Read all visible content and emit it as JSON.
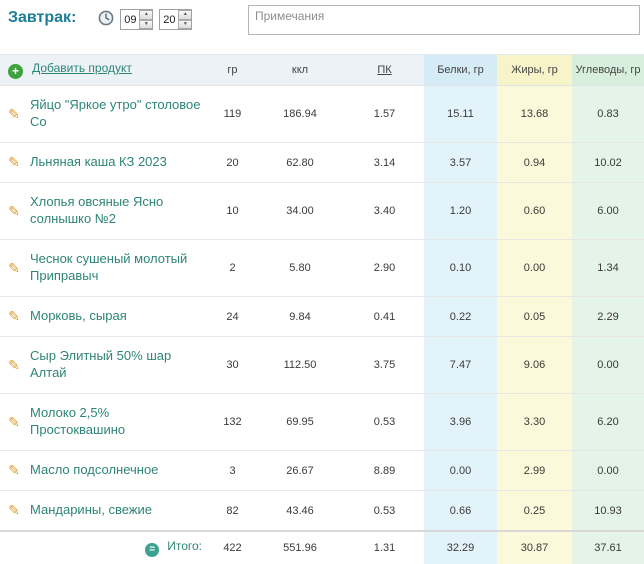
{
  "header": {
    "title": "Завтрак:",
    "time": {
      "hour": "09",
      "minute": "20"
    },
    "notes_placeholder": "Примечания"
  },
  "table": {
    "add_product_label": "Добавить продукт",
    "columns": [
      "гр",
      "ккл",
      "ПК",
      "Белки, гр",
      "Жиры, гр",
      "Углеводы, гр"
    ],
    "rows": [
      {
        "name": "Яйцо \"Яркое утро\" столовое Со",
        "grams": "119",
        "kcal": "186.94",
        "pk": "1.57",
        "protein": "15.11",
        "fat": "13.68",
        "carbs": "0.83"
      },
      {
        "name": "Льняная каша КЗ 2023",
        "grams": "20",
        "kcal": "62.80",
        "pk": "3.14",
        "protein": "3.57",
        "fat": "0.94",
        "carbs": "10.02"
      },
      {
        "name": "Хлопья овсяные Ясно солнышко №2",
        "grams": "10",
        "kcal": "34.00",
        "pk": "3.40",
        "protein": "1.20",
        "fat": "0.60",
        "carbs": "6.00"
      },
      {
        "name": "Чеснок сушеный молотый Приправыч",
        "grams": "2",
        "kcal": "5.80",
        "pk": "2.90",
        "protein": "0.10",
        "fat": "0.00",
        "carbs": "1.34"
      },
      {
        "name": "Морковь, сырая",
        "grams": "24",
        "kcal": "9.84",
        "pk": "0.41",
        "protein": "0.22",
        "fat": "0.05",
        "carbs": "2.29"
      },
      {
        "name": "Сыр Элитный 50% шар Алтай",
        "grams": "30",
        "kcal": "112.50",
        "pk": "3.75",
        "protein": "7.47",
        "fat": "9.06",
        "carbs": "0.00"
      },
      {
        "name": "Молоко 2,5% Простоквашино",
        "grams": "132",
        "kcal": "69.95",
        "pk": "0.53",
        "protein": "3.96",
        "fat": "3.30",
        "carbs": "6.20"
      },
      {
        "name": "Масло подсолнечное",
        "grams": "3",
        "kcal": "26.67",
        "pk": "8.89",
        "protein": "0.00",
        "fat": "2.99",
        "carbs": "0.00"
      },
      {
        "name": "Мандарины, свежие",
        "grams": "82",
        "kcal": "43.46",
        "pk": "0.53",
        "protein": "0.66",
        "fat": "0.25",
        "carbs": "10.93"
      }
    ],
    "total": {
      "label": "Итого:",
      "grams": "422",
      "kcal": "551.96",
      "pk": "1.31",
      "protein": "32.29",
      "fat": "30.87",
      "carbs": "37.61"
    }
  },
  "colors": {
    "accent_teal": "#2e8577",
    "title_teal": "#1d7f96",
    "protein_column": "#e3f3fa",
    "fat_column": "#fbf9d9",
    "carbs_column": "#e4f4e6",
    "add_icon_green": "#3fa23f",
    "pencil_orange": "#dd9a2e"
  }
}
